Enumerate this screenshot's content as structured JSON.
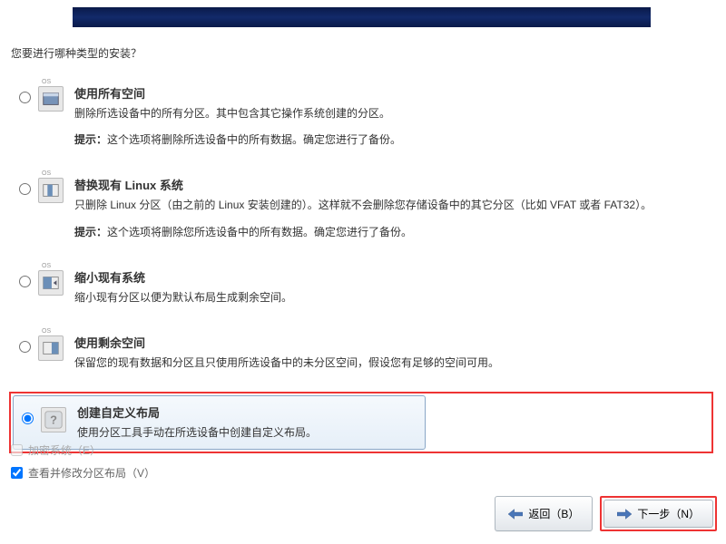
{
  "question": "您要进行哪种类型的安装？",
  "options": [
    {
      "title": "使用所有空间",
      "desc": "删除所选设备中的所有分区。其中包含其它操作系统创建的分区。",
      "hint_label": "提示：",
      "hint_text": "这个选项将删除所选设备中的所有数据。确定您进行了备份。"
    },
    {
      "title": "替换现有 Linux 系统",
      "desc": "只删除 Linux 分区（由之前的 Linux 安装创建的）。这样就不会删除您存储设备中的其它分区（比如 VFAT 或者 FAT32）。",
      "hint_label": "提示：",
      "hint_text": "这个选项将删除您所选设备中的所有数据。确定您进行了备份。"
    },
    {
      "title": "缩小现有系统",
      "desc": "缩小现有分区以便为默认布局生成剩余空间。"
    },
    {
      "title": "使用剩余空间",
      "desc": "保留您的现有数据和分区且只使用所选设备中的未分区空间，假设您有足够的空间可用。"
    },
    {
      "title": "创建自定义布局",
      "desc": "使用分区工具手动在所选设备中创建自定义布局。"
    }
  ],
  "checkboxes": {
    "encrypt": "加密系统（E）",
    "review": "查看并修改分区布局（V）"
  },
  "buttons": {
    "back": "返回（B）",
    "next": "下一步（N）"
  }
}
